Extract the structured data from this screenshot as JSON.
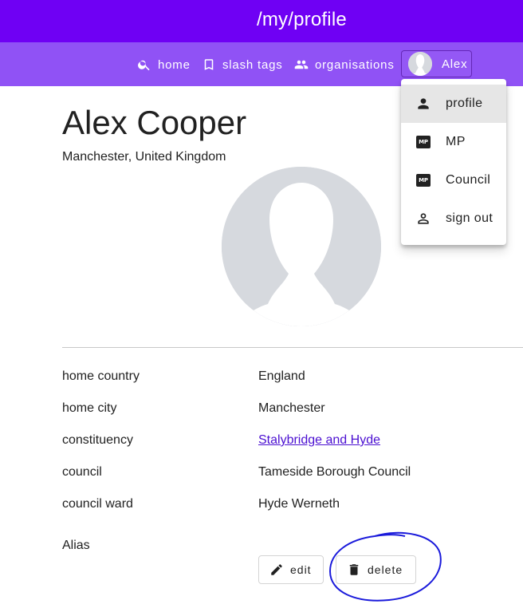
{
  "header": {
    "title": "/my/profile"
  },
  "nav": {
    "home": "home",
    "slash_tags": "slash tags",
    "organisations": "organisations",
    "user": "Alex"
  },
  "menu": {
    "items": [
      {
        "label": "profile",
        "icon": "person-icon",
        "selected": true
      },
      {
        "label": "MP",
        "icon": "mp-badge-icon"
      },
      {
        "label": "Council",
        "icon": "mp-badge-icon"
      },
      {
        "label": "sign out",
        "icon": "person-outline-icon"
      }
    ],
    "badge_text": "MP"
  },
  "profile": {
    "name": "Alex Cooper",
    "location": "Manchester, United Kingdom",
    "fields": [
      {
        "label": "home country",
        "value": "England"
      },
      {
        "label": "home city",
        "value": "Manchester"
      },
      {
        "label": "constituency",
        "value": "Stalybridge and Hyde",
        "link": true
      },
      {
        "label": "council",
        "value": "Tameside Borough Council"
      },
      {
        "label": "council ward",
        "value": "Hyde Werneth"
      }
    ],
    "alias_label": "Alias"
  },
  "actions": {
    "edit": "edit",
    "delete": "delete"
  },
  "colors": {
    "topbar": "#6f00f4",
    "navbar": "#9052f5",
    "link": "#4b0fd1",
    "annotation": "#1a1adb",
    "avatar_bg": "#d6d9de"
  }
}
